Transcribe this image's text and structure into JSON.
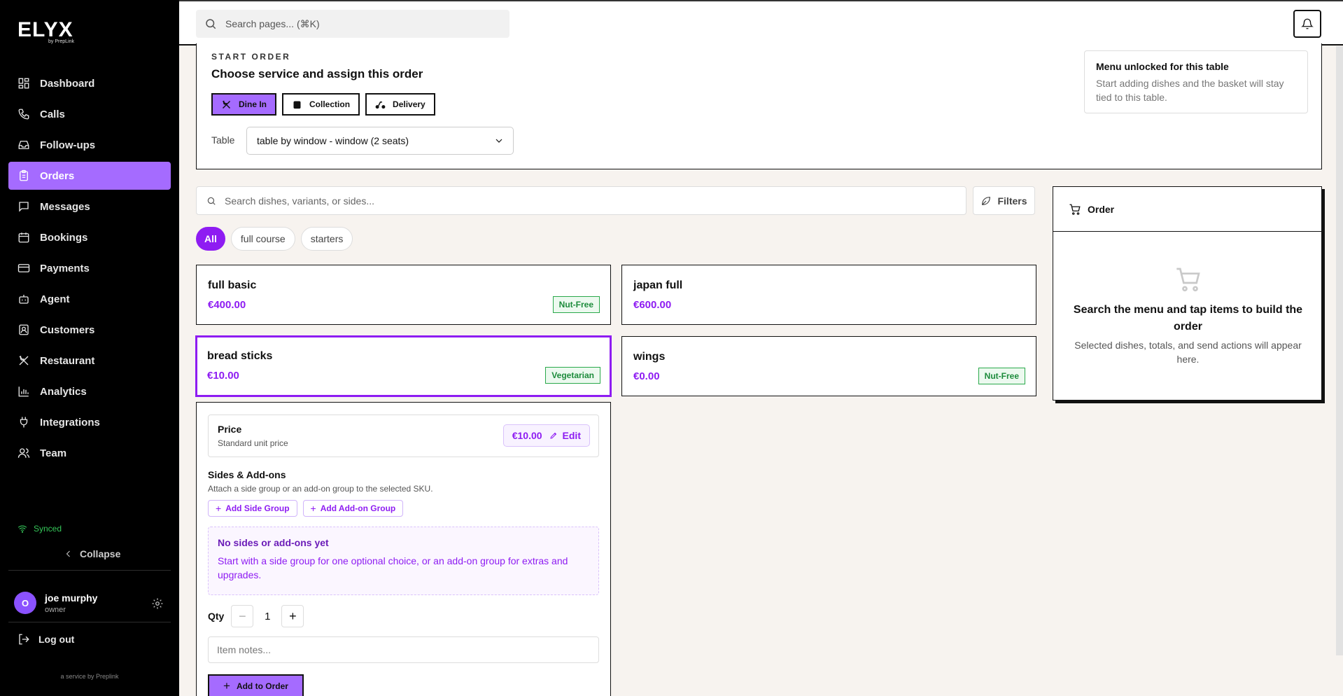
{
  "brand": {
    "name": "ELYX",
    "sub": "by PrepLink"
  },
  "sidebar": {
    "items": [
      {
        "label": "Dashboard",
        "icon": "dashboard-icon"
      },
      {
        "label": "Calls",
        "icon": "phone-icon"
      },
      {
        "label": "Follow-ups",
        "icon": "inbox-icon"
      },
      {
        "label": "Orders",
        "icon": "clipboard-icon",
        "active": true
      },
      {
        "label": "Messages",
        "icon": "message-icon"
      },
      {
        "label": "Bookings",
        "icon": "calendar-icon"
      },
      {
        "label": "Payments",
        "icon": "credit-card-icon"
      },
      {
        "label": "Agent",
        "icon": "bot-icon"
      },
      {
        "label": "Customers",
        "icon": "contact-icon"
      },
      {
        "label": "Restaurant",
        "icon": "utensils-icon"
      },
      {
        "label": "Analytics",
        "icon": "bar-chart-icon"
      },
      {
        "label": "Integrations",
        "icon": "plug-icon"
      },
      {
        "label": "Team",
        "icon": "users-icon"
      }
    ],
    "status": "Synced",
    "collapse_label": "Collapse",
    "user": {
      "initial": "O",
      "name": "joe murphy",
      "role": "owner"
    },
    "logout_label": "Log out",
    "footer": "a service by Preplink"
  },
  "topbar": {
    "search_placeholder": "Search pages... (⌘K)"
  },
  "start_order": {
    "kicker": "START ORDER",
    "title": "Choose service and assign this order",
    "services": [
      "Dine In",
      "Collection",
      "Delivery"
    ],
    "active_service": "Dine In",
    "table_label": "Table",
    "table_value": "table by window - window (2 seats)",
    "notice_title": "Menu unlocked for this table",
    "notice_text": "Start adding dishes and the basket will stay tied to this table."
  },
  "menu": {
    "search_placeholder": "Search dishes, variants, or sides...",
    "filters_label": "Filters",
    "categories": [
      "All",
      "full course",
      "starters"
    ],
    "active_category": "All",
    "dishes": [
      {
        "name": "full basic",
        "price": "€400.00",
        "tag": "Nut-Free"
      },
      {
        "name": "japan full",
        "price": "€600.00",
        "tag": ""
      },
      {
        "name": "bread sticks",
        "price": "€10.00",
        "tag": "Vegetarian",
        "selected": true
      },
      {
        "name": "wings",
        "price": "€0.00",
        "tag": "Nut-Free"
      }
    ]
  },
  "detail": {
    "price_title": "Price",
    "price_sub": "Standard unit price",
    "price_value": "€10.00",
    "edit_label": "Edit",
    "sides_title": "Sides & Add-ons",
    "sides_sub": "Attach a side group or an add-on group to the selected SKU.",
    "add_side_label": "Add Side Group",
    "add_addon_label": "Add Add-on Group",
    "empty_title": "No sides or add-ons yet",
    "empty_text": "Start with a side group for one optional choice, or an add-on group for extras and upgrades.",
    "qty_label": "Qty",
    "qty_value": "1",
    "notes_placeholder": "Item notes...",
    "add_to_order_label": "Add to Order"
  },
  "order": {
    "title": "Order",
    "empty_title": "Search the menu and tap items to build the order",
    "empty_text": "Selected dishes, totals, and send actions will appear here."
  },
  "colors": {
    "accent": "#a56bff",
    "accent_strong": "#8e1cf2",
    "sidebar_bg": "#000000",
    "page_bg": "#f7f3ef",
    "tag_green": "#2aa94b"
  }
}
